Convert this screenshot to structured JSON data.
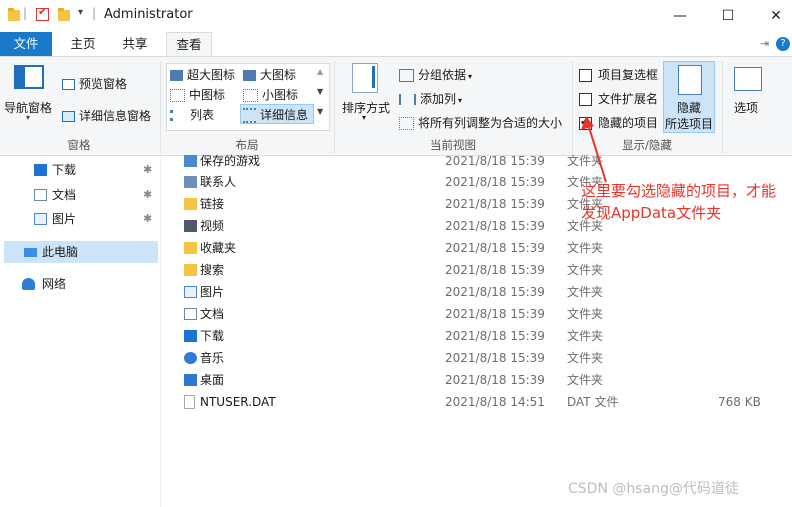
{
  "window": {
    "title": "Administrator",
    "controls": {
      "minimize": "—",
      "maximize": "☐",
      "close": "✕"
    },
    "quick_access_sep": "|",
    "quick_access_arrow": "▾"
  },
  "tabs": [
    {
      "label": "文件"
    },
    {
      "label": "主页"
    },
    {
      "label": "共享"
    },
    {
      "label": "查看"
    }
  ],
  "ribbon": {
    "pane_group": {
      "nav_pane": "导航窗格",
      "preview_pane": "预览窗格",
      "details_pane": "详细信息窗格",
      "label": "窗格"
    },
    "layout_group": {
      "items": [
        "超大图标",
        "大图标",
        "中图标",
        "小图标",
        "列表",
        "详细信息"
      ],
      "label": "布局"
    },
    "current_view_group": {
      "sort_by": "排序方式",
      "group_by": "分组依据",
      "add_column": "添加列",
      "fit_columns": "将所有列调整为合适的大小",
      "label": "当前视图"
    },
    "show_hide_group": {
      "item_checkboxes": {
        "label": "项目复选框",
        "checked": false
      },
      "file_extensions": {
        "label": "文件扩展名",
        "checked": false
      },
      "hidden_items": {
        "label": "隐藏的项目",
        "checked": true
      },
      "hide_selected_line1": "隐藏",
      "hide_selected_line2": "所选项目",
      "label": "显示/隐藏"
    },
    "options": "选项"
  },
  "nav": {
    "quick": [
      {
        "label": "下载",
        "icon": "download-arrow-icon",
        "color": "#1e72d4"
      },
      {
        "label": "文档",
        "icon": "document-icon",
        "color": "#6a88a8"
      },
      {
        "label": "图片",
        "icon": "pictures-icon",
        "color": "#4b86c9"
      }
    ],
    "pin": "📌",
    "this_pc": "此电脑",
    "network": "网络"
  },
  "files": [
    {
      "name": "保存的游戏",
      "date": "2021/8/18 15:39",
      "type": "文件夹",
      "size": ""
    },
    {
      "name": "联系人",
      "date": "2021/8/18 15:39",
      "type": "文件夹",
      "size": ""
    },
    {
      "name": "链接",
      "date": "2021/8/18 15:39",
      "type": "文件夹",
      "size": ""
    },
    {
      "name": "视频",
      "date": "2021/8/18 15:39",
      "type": "文件夹",
      "size": ""
    },
    {
      "name": "收藏夹",
      "date": "2021/8/18 15:39",
      "type": "文件夹",
      "size": ""
    },
    {
      "name": "搜索",
      "date": "2021/8/18 15:39",
      "type": "文件夹",
      "size": ""
    },
    {
      "name": "图片",
      "date": "2021/8/18 15:39",
      "type": "文件夹",
      "size": ""
    },
    {
      "name": "文档",
      "date": "2021/8/18 15:39",
      "type": "文件夹",
      "size": ""
    },
    {
      "name": "下载",
      "date": "2021/8/18 15:39",
      "type": "文件夹",
      "size": ""
    },
    {
      "name": "音乐",
      "date": "2021/8/18 15:39",
      "type": "文件夹",
      "size": ""
    },
    {
      "name": "桌面",
      "date": "2021/8/18 15:39",
      "type": "文件夹",
      "size": ""
    },
    {
      "name": "NTUSER.DAT",
      "date": "2021/8/18 14:51",
      "type": "DAT 文件",
      "size": "768 KB"
    }
  ],
  "annotation": "这里要勾选隐藏的项目，才能发现AppData文件夹",
  "watermark": "CSDN @hsang@代码道徒",
  "colors": {
    "accent": "#1979ca",
    "annotation": "#e8342a",
    "folder": "#f6c445"
  }
}
